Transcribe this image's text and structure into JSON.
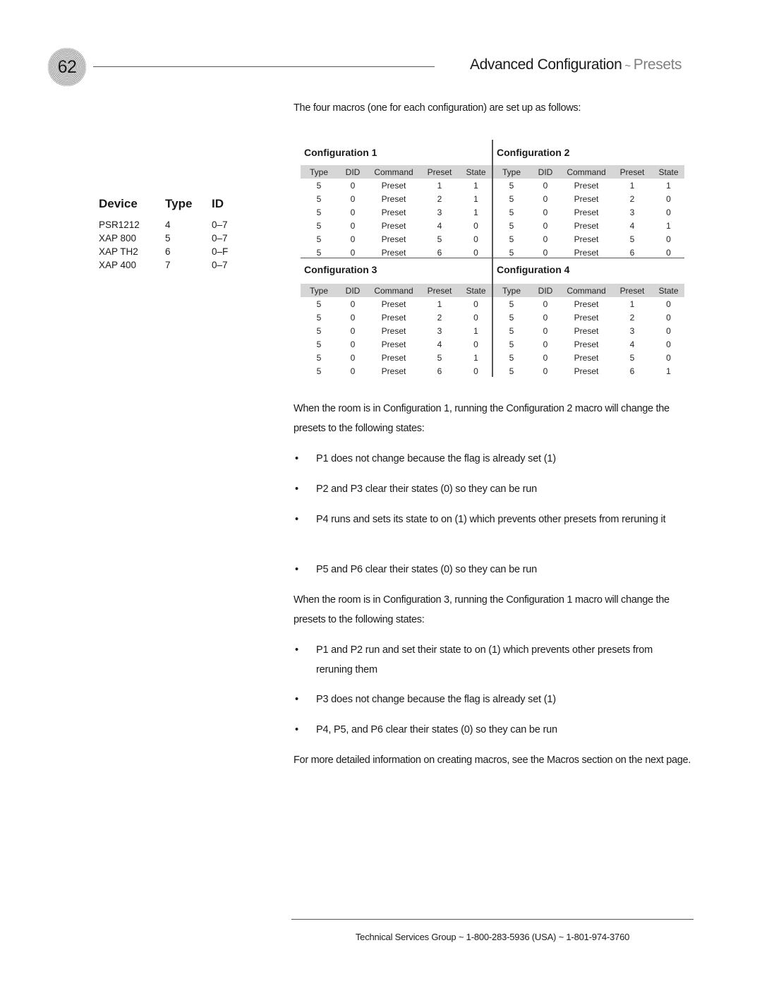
{
  "header": {
    "page_number": "62",
    "title": "Advanced Configuration",
    "separator": "~",
    "subtitle": "Presets"
  },
  "device_table": {
    "headers": [
      "Device",
      "Type",
      "ID"
    ],
    "rows": [
      [
        "PSR1212",
        "4",
        "0–7"
      ],
      [
        "XAP 800",
        "5",
        "0–7"
      ],
      [
        "XAP TH2",
        "6",
        "0–F"
      ],
      [
        "XAP 400",
        "7",
        "0–7"
      ]
    ]
  },
  "intro": "The four macros (one for each configuration) are set up as follows:",
  "config_columns": [
    "Type",
    "DID",
    "Command",
    "Preset",
    "State"
  ],
  "configurations": [
    {
      "title": "Configuration 1",
      "rows": [
        [
          "5",
          "0",
          "Preset",
          "1",
          "1"
        ],
        [
          "5",
          "0",
          "Preset",
          "2",
          "1"
        ],
        [
          "5",
          "0",
          "Preset",
          "3",
          "1"
        ],
        [
          "5",
          "0",
          "Preset",
          "4",
          "0"
        ],
        [
          "5",
          "0",
          "Preset",
          "5",
          "0"
        ],
        [
          "5",
          "0",
          "Preset",
          "6",
          "0"
        ]
      ]
    },
    {
      "title": "Configuration 2",
      "rows": [
        [
          "5",
          "0",
          "Preset",
          "1",
          "1"
        ],
        [
          "5",
          "0",
          "Preset",
          "2",
          "0"
        ],
        [
          "5",
          "0",
          "Preset",
          "3",
          "0"
        ],
        [
          "5",
          "0",
          "Preset",
          "4",
          "1"
        ],
        [
          "5",
          "0",
          "Preset",
          "5",
          "0"
        ],
        [
          "5",
          "0",
          "Preset",
          "6",
          "0"
        ]
      ]
    },
    {
      "title": "Configuration 3",
      "rows": [
        [
          "5",
          "0",
          "Preset",
          "1",
          "0"
        ],
        [
          "5",
          "0",
          "Preset",
          "2",
          "0"
        ],
        [
          "5",
          "0",
          "Preset",
          "3",
          "1"
        ],
        [
          "5",
          "0",
          "Preset",
          "4",
          "0"
        ],
        [
          "5",
          "0",
          "Preset",
          "5",
          "1"
        ],
        [
          "5",
          "0",
          "Preset",
          "6",
          "0"
        ]
      ]
    },
    {
      "title": "Configuration 4",
      "rows": [
        [
          "5",
          "0",
          "Preset",
          "1",
          "0"
        ],
        [
          "5",
          "0",
          "Preset",
          "2",
          "0"
        ],
        [
          "5",
          "0",
          "Preset",
          "3",
          "0"
        ],
        [
          "5",
          "0",
          "Preset",
          "4",
          "0"
        ],
        [
          "5",
          "0",
          "Preset",
          "5",
          "0"
        ],
        [
          "5",
          "0",
          "Preset",
          "6",
          "1"
        ]
      ]
    }
  ],
  "section1": {
    "paragraph": "When the room is in Configuration 1, running the Configuration 2 macro will change the presets to the following states:",
    "bullets": [
      "P1 does not change because the flag is already set (1)",
      "P2 and P3 clear their states (0) so they can be run",
      "P4 runs and sets its state to on (1) which prevents other presets from reruning it",
      "P5 and P6 clear their states (0) so they can be run"
    ]
  },
  "section2": {
    "paragraph": "When the room is in Configuration 3, running the Configuration 1 macro will change the presets to the following states:",
    "bullets": [
      "P1 and P2 run and set their state to on (1) which prevents other presets from reruning them",
      "P3 does not change because the flag is already set (1)",
      "P4, P5, and P6 clear their states (0) so they can be run"
    ]
  },
  "closing": "For more detailed information on creating macros, see the Macros section on the next page.",
  "bullet_glyph": "•",
  "footer": "Technical Services Group ~  1-800-283-5936 (USA) ~  1-801-974-3760"
}
